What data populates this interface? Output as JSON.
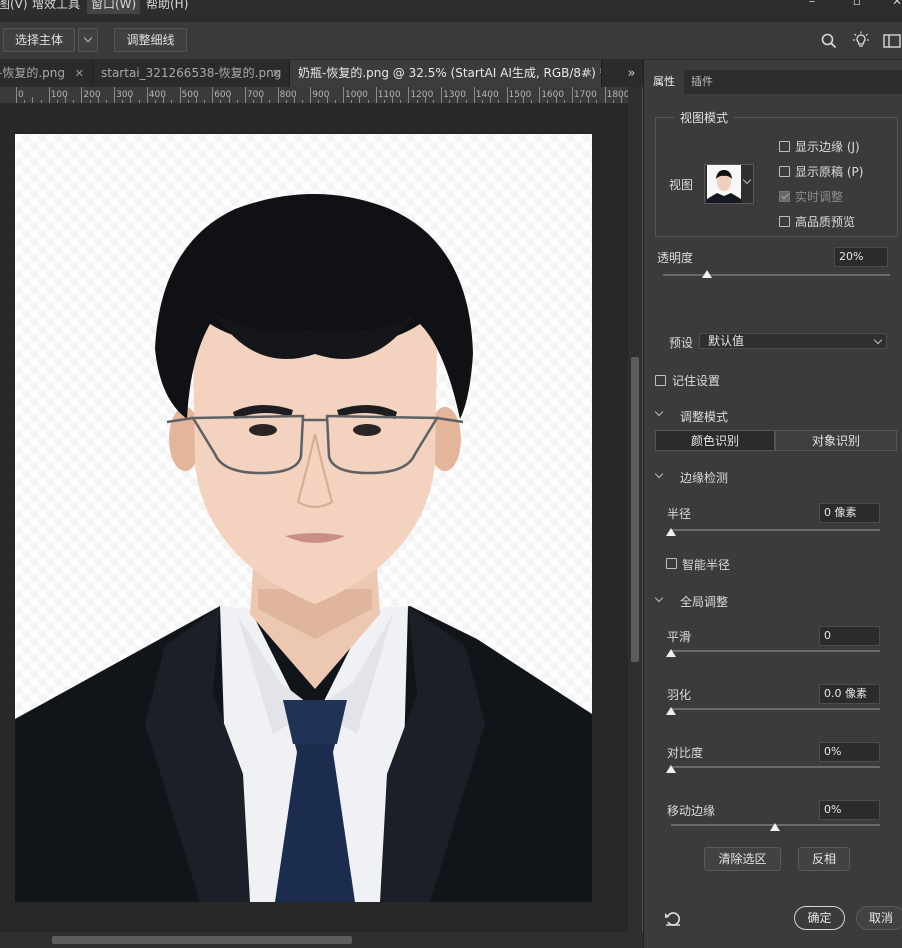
{
  "menubar": {
    "items": [
      "图(V)",
      "增效工具",
      "窗口(W)",
      "帮助(H)"
    ]
  },
  "options": {
    "select_subject": "选择主体",
    "refine_hair": "调整细线"
  },
  "tabs": [
    {
      "label": "-恢复的.png",
      "active": false
    },
    {
      "label": "startai_321266538-恢复的.png",
      "active": false
    },
    {
      "label": "奶瓶-恢复的.png @ 32.5% (StartAI AI生成, RGB/8#) *",
      "active": true
    }
  ],
  "ruler": {
    "labels": [
      "0",
      "100",
      "200",
      "300",
      "400",
      "500",
      "600",
      "700",
      "800",
      "900",
      "1000",
      "1100",
      "1200",
      "1300",
      "1400",
      "1500",
      "1600",
      "1700",
      "1800"
    ]
  },
  "panel": {
    "tabs": [
      "属性",
      "插件"
    ],
    "view_mode": {
      "title": "视图模式",
      "view_label": "视图",
      "show_edge": "显示边缘 (J)",
      "show_original": "显示原稿 (P)",
      "realtime": "实时调整",
      "hq_preview": "高品质预览"
    },
    "opacity": {
      "label": "透明度",
      "value": "20%",
      "level_percent": 20
    },
    "preset": {
      "label": "预设",
      "value": "默认值"
    },
    "remember": "记住设置",
    "adjust_mode": {
      "title": "调整模式",
      "color": "颜色识别",
      "object": "对象识别"
    },
    "edge_detect": {
      "title": "边缘检测",
      "radius_label": "半径",
      "radius_value": "0 像素",
      "smart_radius": "智能半径"
    },
    "global": {
      "title": "全局调整",
      "smooth_label": "平滑",
      "smooth_value": "0",
      "feather_label": "羽化",
      "feather_value": "0.0 像素",
      "contrast_label": "对比度",
      "contrast_value": "0%",
      "shift_label": "移动边缘",
      "shift_value": "0%"
    },
    "buttons": {
      "clear": "清除选区",
      "invert": "反相",
      "ok": "确定",
      "cancel": "取消"
    }
  }
}
